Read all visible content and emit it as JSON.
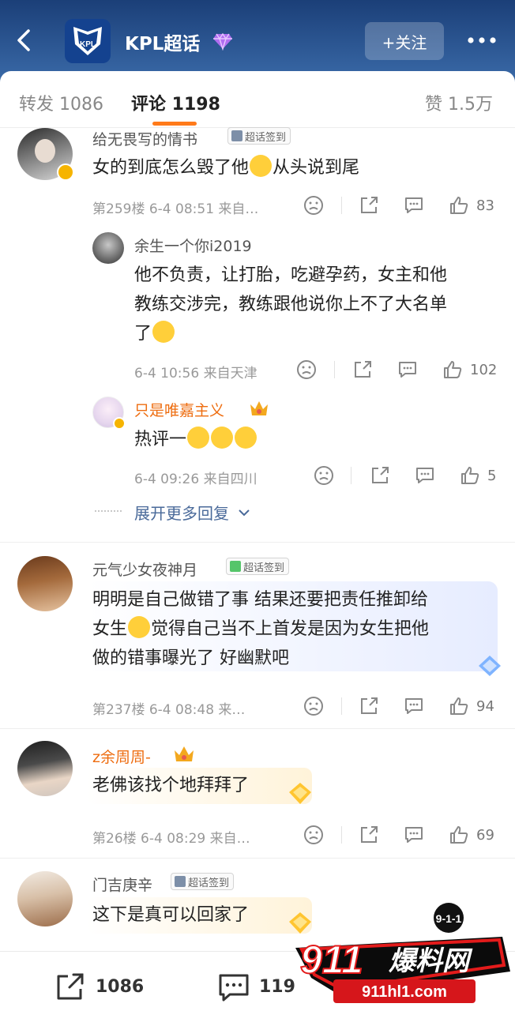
{
  "header": {
    "title": "KPL超话",
    "logo_text": "KPL",
    "follow_label": "+关注"
  },
  "tabs": {
    "repost": "转发 1086",
    "comment": "评论 1198",
    "like": "赞 1.5万"
  },
  "comments": [
    {
      "user": "给无畏写的情书",
      "badge": "超话签到",
      "text_a": "女的到底怎么毁了他",
      "text_b": "从头说到尾",
      "meta": "第259楼 6-4 08:51 来自…",
      "likes": "83",
      "replies": [
        {
          "user": "余生一个你i2019",
          "line1": "他不负责，让打胎，吃避孕药，女主和他",
          "line2": "教练交涉完，教练跟他说你上不了大名单",
          "line3": "了",
          "meta": "6-4 10:56 来自天津",
          "likes": "102"
        },
        {
          "user": "只是唯嘉主义",
          "text": "热评一",
          "meta": "6-4 09:26 来自四川",
          "likes": "5"
        }
      ],
      "expand": "展开更多回复"
    },
    {
      "user": "元气少女夜神月",
      "badge": "超话签到",
      "line1": "明明是自己做错了事 结果还要把责任推卸给",
      "line2a": "女生",
      "line2b": "觉得自己当不上首发是因为女生把他",
      "line3": "做的错事曝光了 好幽默吧",
      "meta": "第237楼 6-4 08:48 来…",
      "likes": "94"
    },
    {
      "user": "z余周周-",
      "text": "老佛该找个地拜拜了",
      "meta": "第26楼 6-4 08:29 来自…",
      "likes": "69"
    },
    {
      "user": "门吉庚辛",
      "badge": "超话签到",
      "text": "这下是真可以回家了"
    }
  ],
  "bottom": {
    "repost_count": "1086",
    "comment_count": "119"
  },
  "watermark": {
    "number": "911",
    "brand": "爆料网",
    "url": "911hl1.com",
    "tag": "9-1-1"
  },
  "colors": {
    "header_top": "#1b3f78",
    "accent_orange": "#ff7a1a",
    "username_orange": "#ee6d10"
  }
}
